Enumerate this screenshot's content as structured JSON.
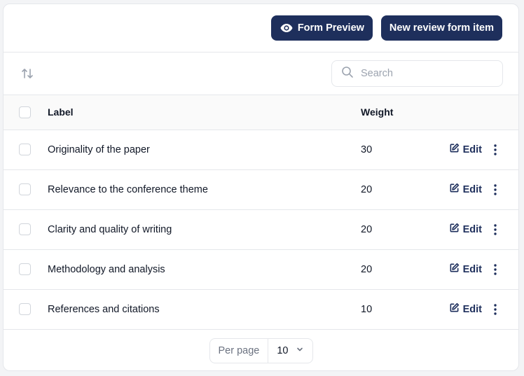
{
  "header": {
    "preview_button_label": "Form Preview",
    "preview_icon": "eye-icon",
    "new_item_button_label": "New review form item"
  },
  "toolbar": {
    "sort_icon": "sort-arrows-icon",
    "search": {
      "placeholder": "Search",
      "value": ""
    }
  },
  "table": {
    "columns": {
      "label": "Label",
      "weight": "Weight"
    },
    "edit_label": "Edit",
    "rows": [
      {
        "label": "Originality of the paper",
        "weight": "30"
      },
      {
        "label": "Relevance to the conference theme",
        "weight": "20"
      },
      {
        "label": "Clarity and quality of writing",
        "weight": "20"
      },
      {
        "label": "Methodology and analysis",
        "weight": "20"
      },
      {
        "label": "References and citations",
        "weight": "10"
      }
    ]
  },
  "pagination": {
    "per_page_label": "Per page",
    "per_page_value": "10"
  },
  "colors": {
    "primary": "#1e2f5c",
    "border": "#e5e7eb",
    "muted": "#9ca3af"
  }
}
